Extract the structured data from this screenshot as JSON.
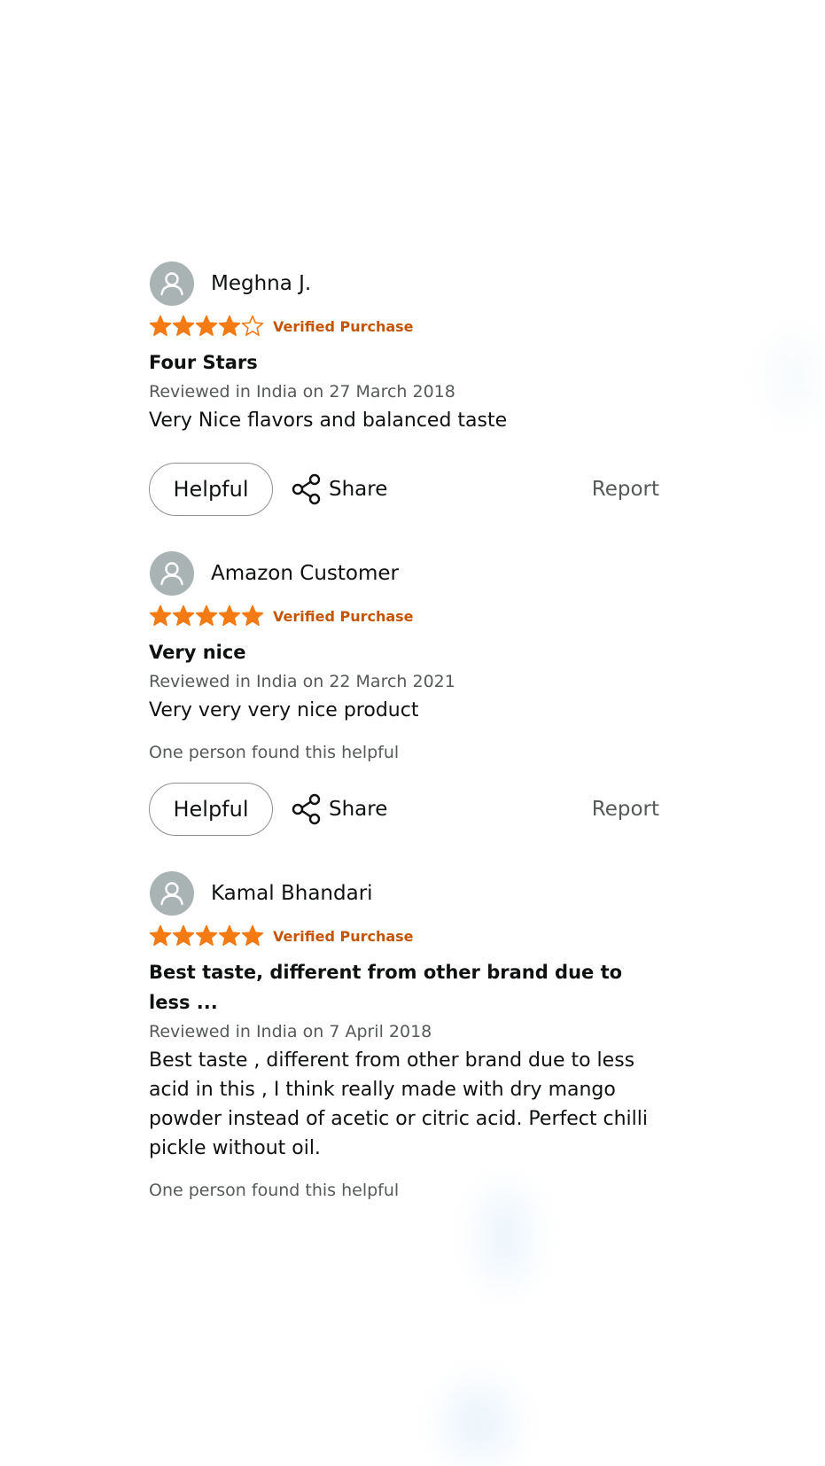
{
  "verified_label": "Verified Purchase",
  "actions": {
    "helpful_label": "Helpful",
    "share_label": "Share",
    "report_label": "Report"
  },
  "colors": {
    "star": "#f47a13",
    "verified": "#c45500",
    "avatar_bg": "#aab3b4"
  },
  "icons": {
    "avatar": "person-avatar-icon",
    "share": "share-icon",
    "star_filled": "star-filled-icon",
    "star_empty": "star-empty-icon"
  },
  "reviews": [
    {
      "name": "Meghna J.",
      "rating": 4,
      "title": "Four Stars",
      "date": "Reviewed in India on 27 March 2018",
      "body": "Very Nice flavors and balanced taste",
      "helpful_count": ""
    },
    {
      "name": "Amazon Customer",
      "rating": 5,
      "title": "Very nice",
      "date": "Reviewed in India on 22 March 2021",
      "body": "Very very very nice product",
      "helpful_count": "One person found this helpful"
    },
    {
      "name": "Kamal Bhandari",
      "rating": 5,
      "title": "Best taste, different from other brand due to less ...",
      "date": "Reviewed in India on 7 April 2018",
      "body": "Best taste , different from other brand due to less acid in this , I think really made with dry mango powder instead of acetic or citric acid. Perfect chilli pickle without oil.",
      "helpful_count": "One person found this helpful"
    }
  ]
}
